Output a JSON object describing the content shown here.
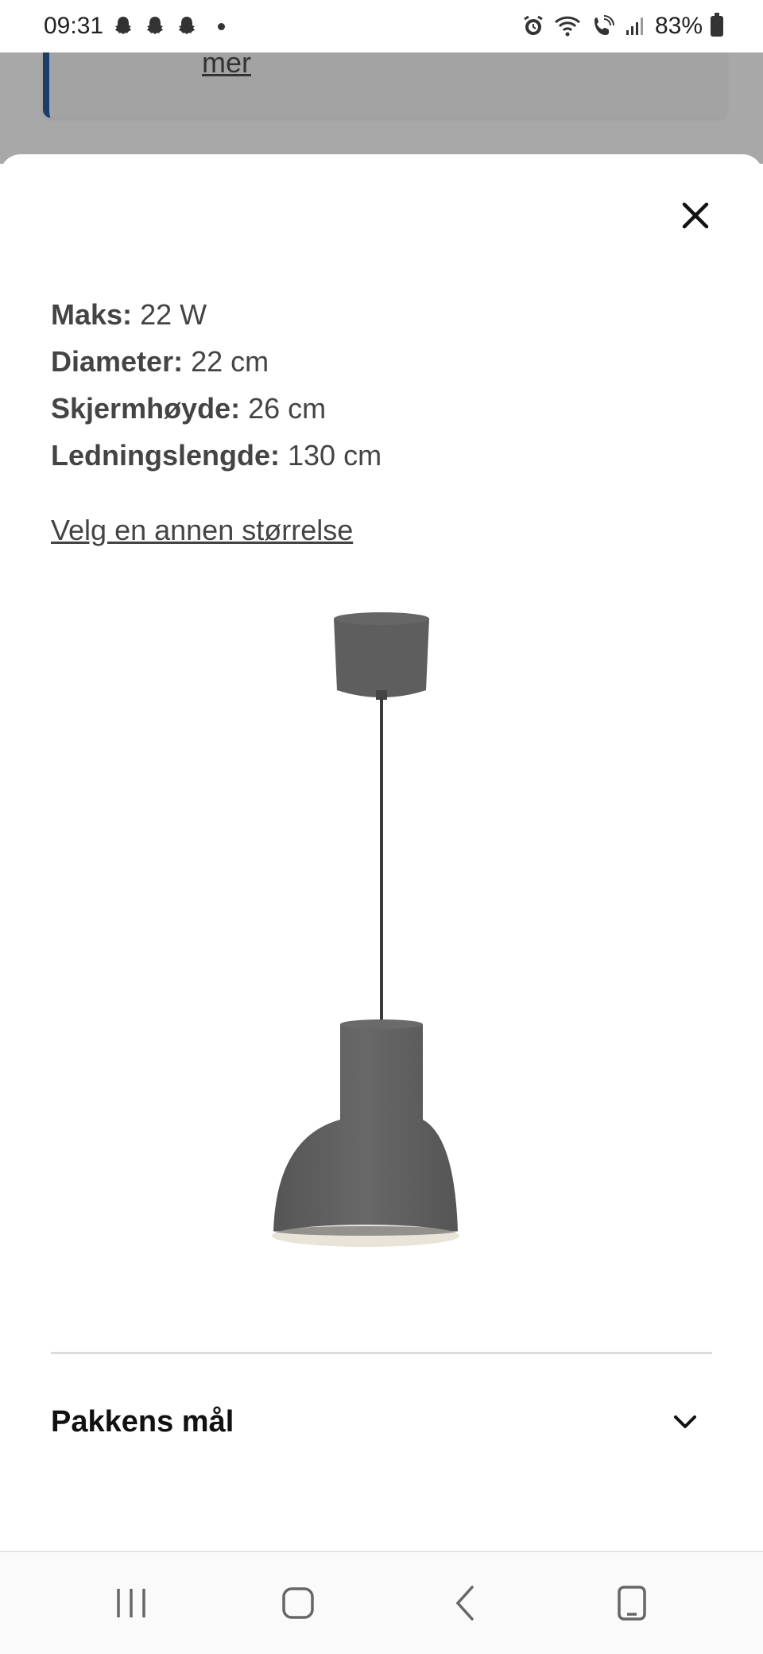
{
  "status_bar": {
    "time": "09:31",
    "battery": "83%",
    "icons": [
      "snapchat-icon",
      "snapchat-icon",
      "snapchat-icon",
      "notification-dot",
      "alarm-icon",
      "wifi-icon",
      "wifi-call-icon",
      "signal-icon",
      "battery-icon"
    ]
  },
  "background": {
    "link_text": "mer",
    "accent_color": "#1a3c6e"
  },
  "sheet": {
    "specs": [
      {
        "label": "Maks:",
        "value": "22 W"
      },
      {
        "label": "Diameter:",
        "value": "22 cm"
      },
      {
        "label": "Skjermhøyde:",
        "value": "26 cm"
      },
      {
        "label": "Ledningslengde:",
        "value": "130 cm"
      }
    ],
    "size_link": "Velg en annen størrelse",
    "accordion": {
      "title": "Pakkens mål"
    }
  },
  "nav": {
    "buttons": [
      "recent-apps-icon",
      "home-icon",
      "back-icon",
      "rotate-screen-icon"
    ]
  }
}
